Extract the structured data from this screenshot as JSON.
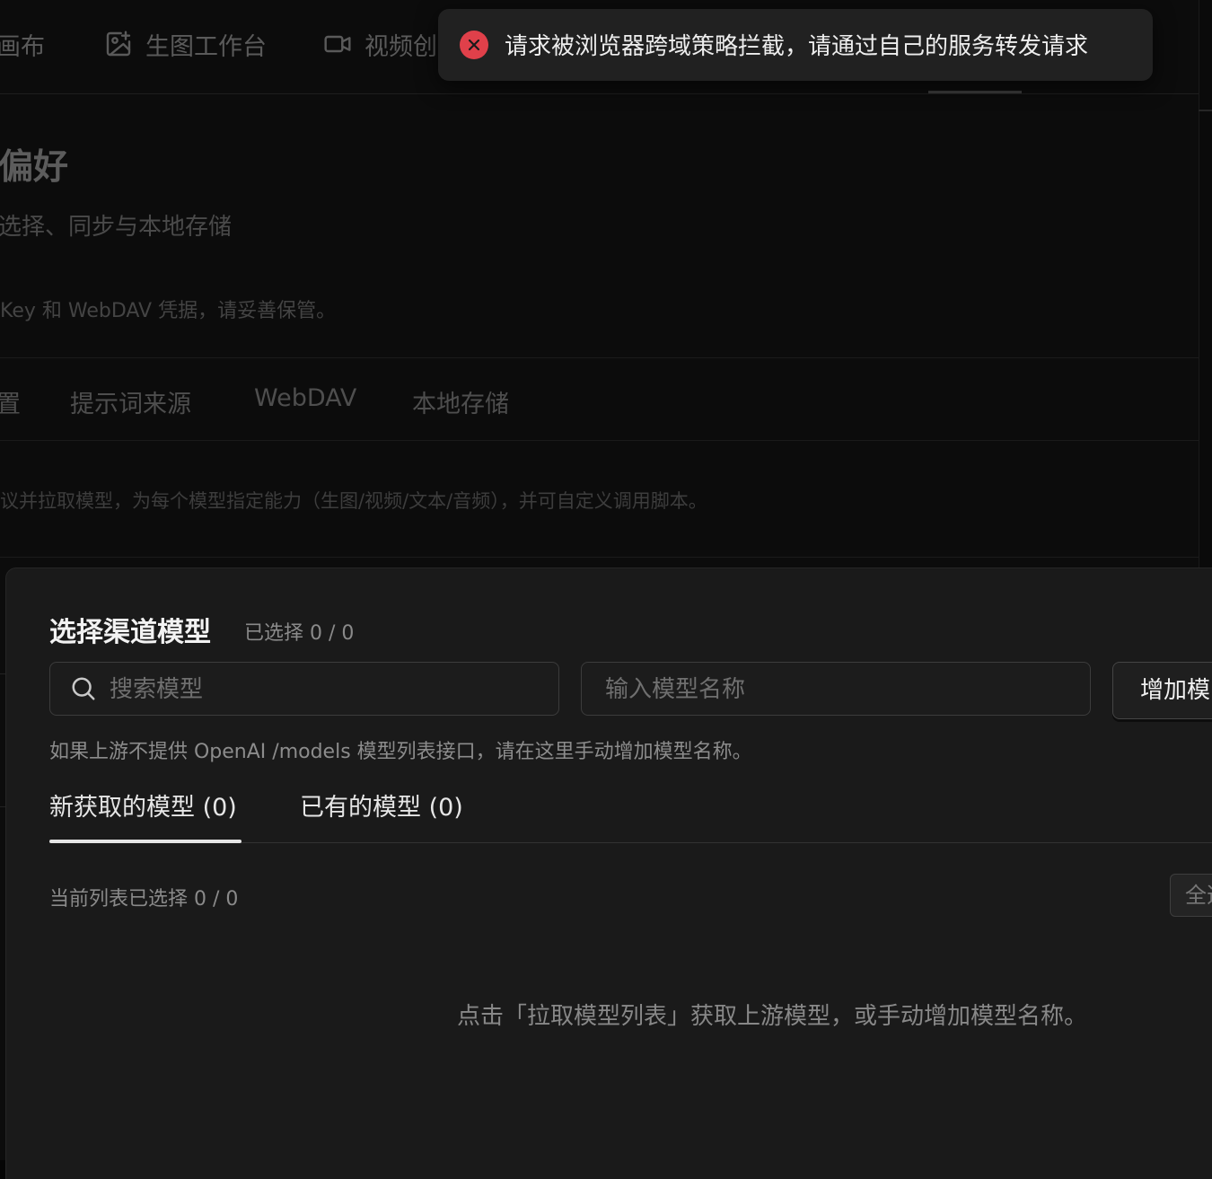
{
  "nav": {
    "items": [
      {
        "label": "画布",
        "icon": "canvas-icon"
      },
      {
        "label": "生图工作台",
        "icon": "image-edit-icon"
      },
      {
        "label": "视频创",
        "icon": "video-icon"
      }
    ]
  },
  "settings": {
    "title": "偏好",
    "subtitle": "选择、同步与本地存储",
    "warning": "Key 和 WebDAV 凭据，请妥善保管。",
    "tabs": [
      "置",
      "提示词来源",
      "WebDAV",
      "本地存储"
    ],
    "description": "议并拉取模型，为每个模型指定能力（生图/视频/文本/音频），并可自定义调用脚本。"
  },
  "modal": {
    "title": "选择渠道模型",
    "selected_count": "已选择 0 / 0",
    "search_placeholder": "搜索模型",
    "model_name_placeholder": "输入模型名称",
    "add_button": "增加模",
    "hint": "如果上游不提供 OpenAI /models 模型列表接口，请在这里手动增加模型名称。",
    "tabs": [
      {
        "label": "新获取的模型 (0)",
        "active": true
      },
      {
        "label": "已有的模型 (0)",
        "active": false
      }
    ],
    "list_selected": "当前列表已选择 0 / 0",
    "select_all_button": "全选",
    "empty_text": "点击「拉取模型列表」获取上游模型，或手动增加模型名称。"
  },
  "toast": {
    "type": "error",
    "icon": "close-circle-icon",
    "message": "请求被浏览器跨域策略拦截，请通过自己的服务转发请求",
    "color": "#e0404a"
  }
}
